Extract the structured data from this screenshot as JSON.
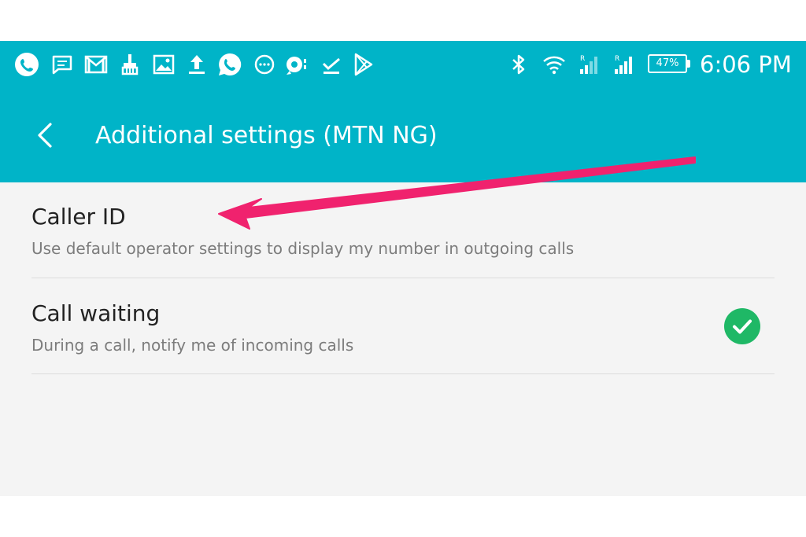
{
  "status_bar": {
    "notification_icons": [
      "phone-icon",
      "message-icon",
      "gmail-icon",
      "cleaner-icon",
      "image-icon",
      "upload-icon",
      "whatsapp-icon",
      "chat-icon",
      "sync-icon",
      "download-done-icon",
      "play-store-icon"
    ],
    "system_icons": [
      "bluetooth-icon",
      "wifi-icon",
      "signal-sim1-icon",
      "signal-sim2-icon"
    ],
    "battery_percent": "47%",
    "time": "6:06 PM"
  },
  "header": {
    "title": "Additional settings (MTN NG)",
    "back_icon": "chevron-left-icon"
  },
  "settings": {
    "caller_id": {
      "title": "Caller ID",
      "summary": "Use default operator settings to display my number in outgoing calls"
    },
    "call_waiting": {
      "title": "Call waiting",
      "summary": "During a call, notify me of incoming calls",
      "checked": true
    }
  },
  "colors": {
    "app_bar": "#00b4c8",
    "background": "#f4f4f4",
    "check": "#1fb866",
    "annotation_arrow": "#f0226e"
  }
}
